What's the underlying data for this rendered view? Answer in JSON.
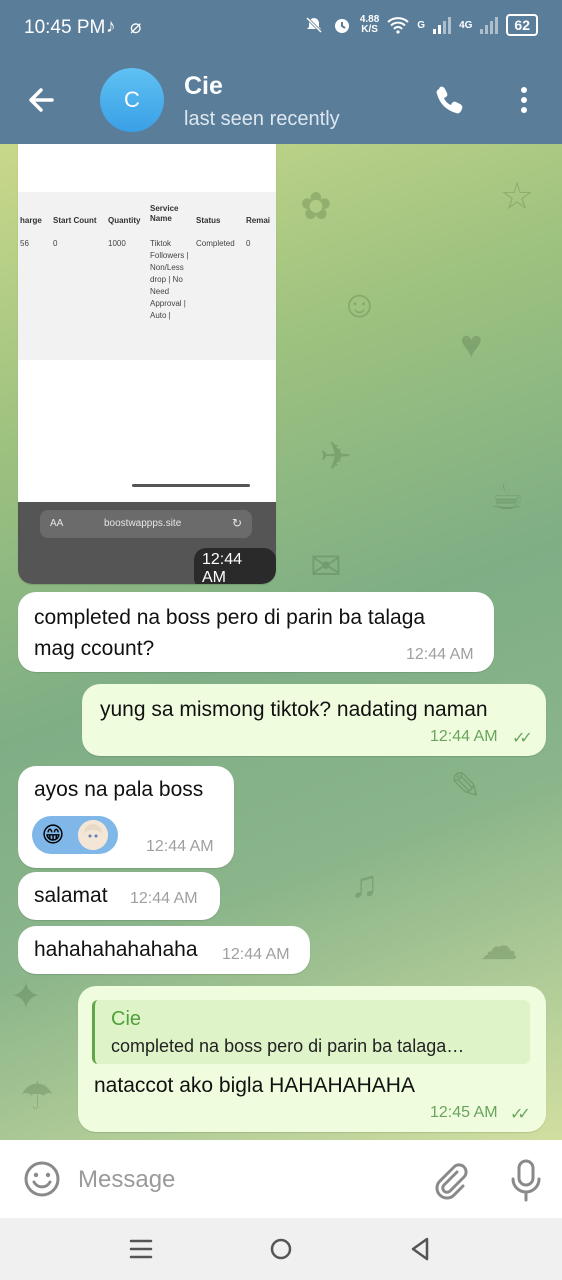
{
  "status_bar": {
    "time": "10:45 PM",
    "speed_value": "4.88",
    "speed_unit": "K/S",
    "net_g": "G",
    "net_4g": "4G",
    "battery": "62",
    "app_icons": [
      "tiktok-icon",
      "paperclip-icon"
    ]
  },
  "header": {
    "avatar_letter": "C",
    "name": "Cie",
    "status": "last seen recently"
  },
  "image_message": {
    "table_headers": [
      "harge",
      "Start Count",
      "Quantity",
      "Service Name",
      "Status",
      "Remai"
    ],
    "row": {
      "charge": "56",
      "start_count": "0",
      "quantity": "1000",
      "service": "Tiktok Followers | Non/Less drop | No Need Approval | Auto |",
      "status": "Completed",
      "remains": "0"
    },
    "url_aa": "AA",
    "url": "boostwappps.site",
    "time": "12:44 AM"
  },
  "messages": [
    {
      "dir": "in",
      "text": "completed na boss pero di parin ba talaga mag ccount?",
      "time": "12:44 AM"
    },
    {
      "dir": "out",
      "text": "yung sa mismong tiktok? nadating naman",
      "time": "12:44 AM"
    },
    {
      "dir": "in",
      "text": "ayos na pala boss",
      "time": "12:44 AM"
    },
    {
      "dir": "in",
      "text": "salamat",
      "time": "12:44 AM"
    },
    {
      "dir": "in",
      "text": "hahahahahahaha",
      "time": "12:44 AM"
    },
    {
      "dir": "out",
      "reply_name": "Cie",
      "reply_text": "completed na boss pero di parin ba talaga…",
      "text": "nataccot ako bigla HAHAHAHAHA",
      "time": "12:45 AM"
    }
  ],
  "emoji": {
    "grin": "😁"
  },
  "composer": {
    "placeholder": "Message"
  }
}
